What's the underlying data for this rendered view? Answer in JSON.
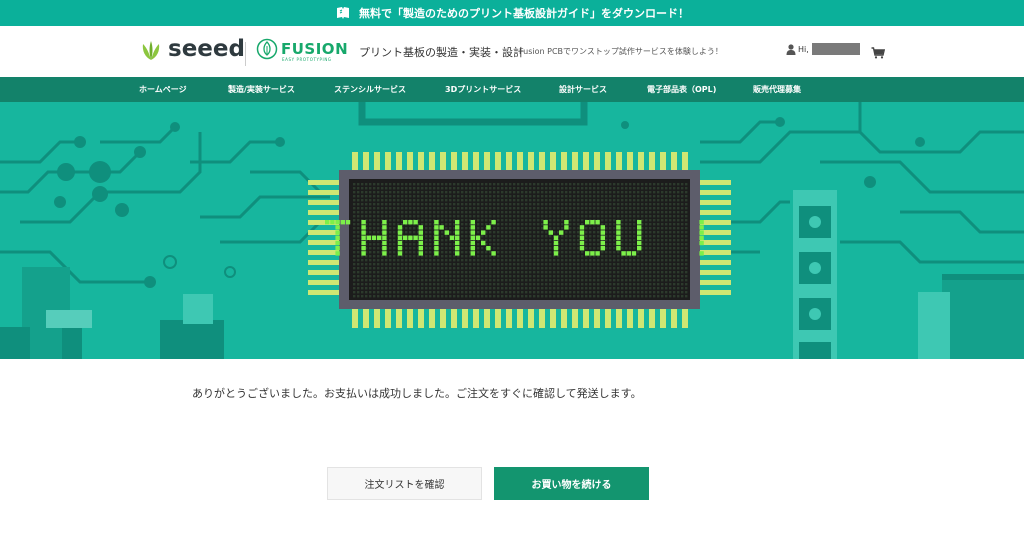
{
  "promo": {
    "text": "無料で「製造のためのプリント基板設計ガイド」をダウンロード！",
    "icon": "book-icon"
  },
  "header": {
    "logo_seeed": "seeed",
    "logo_fusion": "FUSION",
    "logo_fusion_sub": "EASY PROTOTYPING",
    "tagline": "プリント基板の製造・実装・設計",
    "tagline_sub": "Fusion PCBでワンストップ試作サービスを体験しよう！",
    "user_greeting": "Hi,",
    "cart_icon": "cart-icon",
    "user_icon": "user-icon"
  },
  "nav": {
    "items": [
      {
        "label": "ホームページ"
      },
      {
        "label": "製造/実装サービス"
      },
      {
        "label": "ステンシルサービス"
      },
      {
        "label": "3Dプリントサービス"
      },
      {
        "label": "設計サービス"
      },
      {
        "label": "電子部品表（OPL)"
      },
      {
        "label": "販売代理募集"
      }
    ]
  },
  "hero": {
    "banner_text": "THANK YOU !",
    "colors": {
      "background": "#17b69e",
      "trace": "#0f8f7d",
      "chip_body": "#1c1c1c",
      "chip_border": "#5d5d6b",
      "pins": "#cfe773",
      "letters": "#7df04a"
    }
  },
  "main": {
    "message": "ありがとうございました。お支払いは成功しました。ご注文をすぐに確認して発送します。",
    "order_list_button": "注文リストを確認",
    "continue_shopping_button": "お買い物を続ける"
  },
  "colors": {
    "brand_teal": "#0bb09a",
    "nav_green": "#13826a",
    "button_green": "#13956f"
  }
}
